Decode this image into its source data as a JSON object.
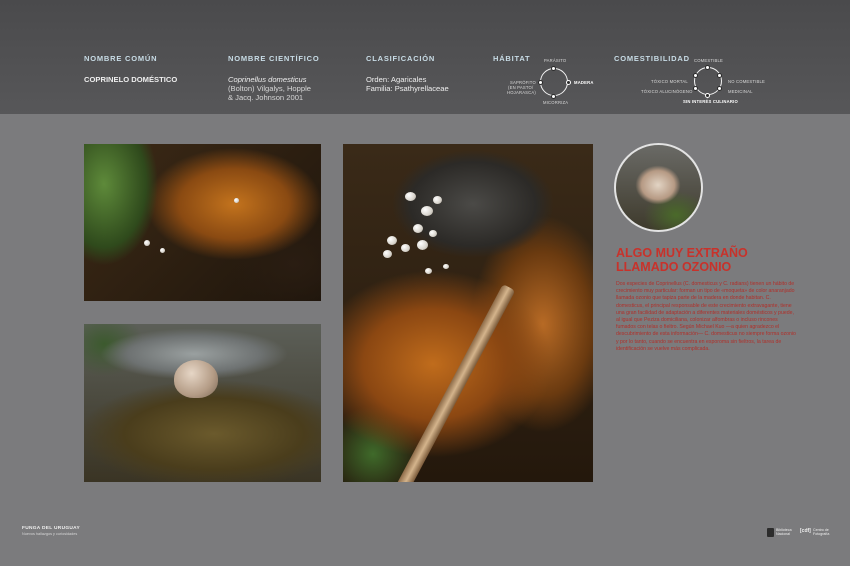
{
  "header": {
    "common_name_label": "NOMBRE COMÚN",
    "common_name": "COPRINELO DOMÉSTICO",
    "scientific_name_label": "NOMBRE CIENTÍFICO",
    "scientific_name_italic": "Coprinellus domesticus",
    "scientific_authors_1": "(Bolton) Vilgalys, Hopple",
    "scientific_authors_2": "& Jacq. Johnson 2001",
    "classification_label": "CLASIFICACIÓN",
    "classification_order": "Orden:   Agaricales",
    "classification_family": "Familia: Psathyrellaceae",
    "habitat_label": "HÁBITAT",
    "habitat": {
      "top": "PARÁSITO",
      "left_1": "SAPRÓFITO",
      "left_2": "(EN PASTO/",
      "left_3": "HOJARASCA)",
      "right": "MADERA",
      "bottom": "MICORRIZA",
      "selected": "MADERA"
    },
    "edibility_label": "COMESTIBILIDAD",
    "edibility": {
      "top": "COMESTIBLE",
      "left_1": "TÓXICO MORTAL",
      "left_2": "TÓXICO ALUCINÓGENO",
      "right_1": "NO COMESTIBLE",
      "right_2": "MEDICINAL",
      "bottom": "SIN INTERÉS CULINARIO",
      "selected": "SIN INTERÉS CULINARIO"
    }
  },
  "article": {
    "title_line_1": "ALGO MUY EXTRAÑO",
    "title_line_2": "LLAMADO OZONIO",
    "body": "Dos especies de Coprinellus (C. domesticus y C. radians) tienen un hábito de crecimiento muy particular: forman un tipo de «moqueta» de color anaranjado llamada ozonio que tapiza parte de la madera en donde habitan. C. domesticus, el principal responsable de este crecimiento extravagante, tiene una gran facilidad de adaptación a diferentes materiales domésticos y puede, al igual que Peziza domiciliana, colonizar alfombras o incluso rincones fumados con telas o fieltro. Según Michael Kuo —a quien agradezco el descubrimiento de esta información— C. domesticus no siempre forma ozonio y por lo tanto, cuando se encuentra en esporoma sin fieltros, la tarea de identificación se vuelve más complicada."
  },
  "footer": {
    "title": "FUNGA DEL URUGUAY",
    "subtitle": "Nuevos hallazgos y curiosidades",
    "logo_1_text": "Biblioteca Nacional",
    "logo_2_mark": "[cdf]",
    "logo_2_text": "Centro de Fotografía"
  },
  "colors": {
    "header_bg": "#4f4f51",
    "page_bg": "#7b7b7d",
    "label_color": "#c8dce6",
    "accent_red": "#c8322b"
  }
}
